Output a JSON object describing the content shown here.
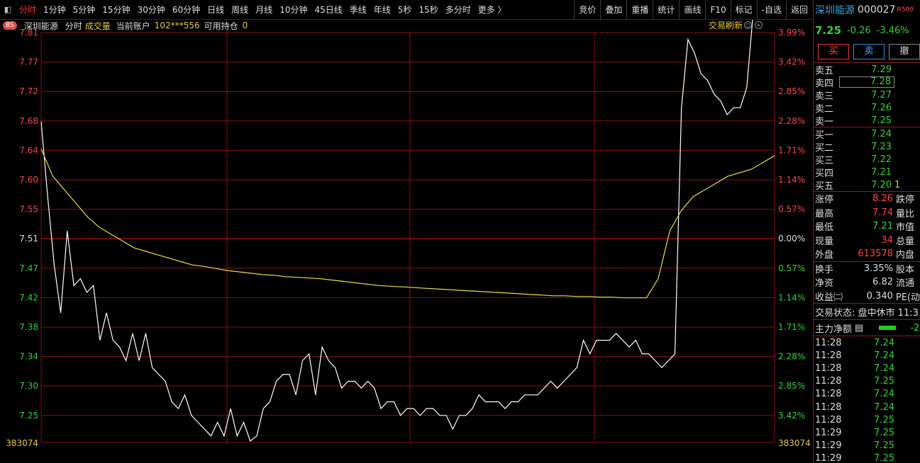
{
  "toolbar": {
    "tabs": [
      "分时",
      "1分钟",
      "5分钟",
      "15分钟",
      "30分钟",
      "60分钟",
      "日线",
      "周线",
      "月线",
      "10分钟",
      "45日线",
      "季线",
      "年线",
      "5秒",
      "15秒",
      "多分时",
      "更多 〉"
    ],
    "active_tab": "分时",
    "tools": [
      "竞价",
      "叠加",
      "重播",
      "统计",
      "画线",
      "F10",
      "标记",
      "-自选",
      "返回"
    ]
  },
  "infobar": {
    "badge": "BS",
    "name": "深圳能源",
    "mode": "分时",
    "volume_label": "成交量",
    "account_label": "当前账户",
    "account": "102***556",
    "position_label": "可用持仓",
    "position": "0",
    "refresh": "交易刷新"
  },
  "chart_data": {
    "type": "line",
    "y_labels_left": [
      "7.81",
      "7.77",
      "7.72",
      "7.68",
      "7.64",
      "7.60",
      "7.55",
      "7.51",
      "7.47",
      "7.42",
      "7.38",
      "7.34",
      "7.30",
      "7.25"
    ],
    "y_labels_right": [
      "3.99%",
      "3.42%",
      "2.85%",
      "2.28%",
      "1.71%",
      "1.14%",
      "0.57%",
      "0.00%",
      "0.57%",
      "1.14%",
      "1.71%",
      "2.28%",
      "2.85%",
      "3.42%"
    ],
    "ylim": [
      7.21,
      7.81
    ],
    "prev_close": 7.51,
    "volume_label_left": "383074",
    "volume_label_right": "383074",
    "colors": {
      "price": "#ffffff",
      "average": "#e8e03a",
      "grid": "#8a1010",
      "up": "#ff4444",
      "down": "#33d433"
    },
    "series": [
      {
        "values": [
          7.68,
          7.57,
          7.47,
          7.4,
          7.52,
          7.44,
          7.45,
          7.43,
          7.44,
          7.36,
          7.4,
          7.36,
          7.35,
          7.33,
          7.37,
          7.33,
          7.37,
          7.32,
          7.31,
          7.3,
          7.27,
          7.26,
          7.28,
          7.25,
          7.24,
          7.23,
          7.22,
          7.24,
          7.22,
          7.26,
          7.22,
          7.24,
          7.21,
          7.22,
          7.26,
          7.27,
          7.3,
          7.31,
          7.31,
          7.28,
          7.33,
          7.34,
          7.28,
          7.35,
          7.33,
          7.32,
          7.29,
          7.3,
          7.3,
          7.29,
          7.3,
          7.29,
          7.26,
          7.27,
          7.27,
          7.25,
          7.26,
          7.26,
          7.25,
          7.26,
          7.26,
          7.25,
          7.25,
          7.23,
          7.25,
          7.25,
          7.26,
          7.28,
          7.27,
          7.27,
          7.27,
          7.26,
          7.27,
          7.27,
          7.28,
          7.28,
          7.28,
          7.29,
          7.3,
          7.29,
          7.3,
          7.31,
          7.32,
          7.36,
          7.34,
          7.36,
          7.36,
          7.36,
          7.37,
          7.36,
          7.35,
          7.36,
          7.34,
          7.34,
          7.33,
          7.32,
          7.33,
          7.34,
          7.7,
          7.8,
          7.78,
          7.75,
          7.74,
          7.72,
          7.71,
          7.69,
          7.7,
          7.7,
          7.73,
          7.85
        ]
      },
      {
        "values": [
          7.64,
          7.6,
          7.58,
          7.56,
          7.54,
          7.525,
          7.515,
          7.505,
          7.495,
          7.49,
          7.485,
          7.48,
          7.475,
          7.47,
          7.468,
          7.465,
          7.462,
          7.46,
          7.458,
          7.456,
          7.455,
          7.453,
          7.452,
          7.451,
          7.45,
          7.448,
          7.446,
          7.444,
          7.442,
          7.44,
          7.439,
          7.438,
          7.437,
          7.436,
          7.435,
          7.434,
          7.433,
          7.432,
          7.431,
          7.43,
          7.429,
          7.428,
          7.427,
          7.426,
          7.425,
          7.425,
          7.424,
          7.424,
          7.423,
          7.423,
          7.422,
          7.422,
          7.422,
          7.45,
          7.52,
          7.55,
          7.57,
          7.58,
          7.59,
          7.6,
          7.605,
          7.61,
          7.62,
          7.63
        ]
      }
    ]
  },
  "panel": {
    "name": "深圳能源",
    "code": "000027",
    "r500": "R500",
    "price": "7.25",
    "change": "-0.26",
    "change_pct": "-3.46%",
    "buttons": [
      "买",
      "卖",
      "撤"
    ],
    "asks": [
      {
        "label": "卖五",
        "price": "7.29"
      },
      {
        "label": "卖四",
        "price": "7.28"
      },
      {
        "label": "卖三",
        "price": "7.27"
      },
      {
        "label": "卖二",
        "price": "7.26"
      },
      {
        "label": "卖一",
        "price": "7.25"
      }
    ],
    "bids": [
      {
        "label": "买一",
        "price": "7.24",
        "vol": ""
      },
      {
        "label": "买二",
        "price": "7.23",
        "vol": ""
      },
      {
        "label": "买三",
        "price": "7.22",
        "vol": ""
      },
      {
        "label": "买四",
        "price": "7.21",
        "vol": ""
      },
      {
        "label": "买五",
        "price": "7.20",
        "vol": "1"
      }
    ],
    "stats": [
      {
        "label": "涨停",
        "value": "8.26",
        "color": "red",
        "label2": "跌停"
      },
      {
        "label": "最高",
        "value": "7.74",
        "color": "red",
        "label2": "量比"
      },
      {
        "label": "最低",
        "value": "7.21",
        "color": "green",
        "label2": "市值"
      },
      {
        "label": "现量",
        "value": "34",
        "color": "red",
        "label2": "总量"
      },
      {
        "label": "外盘",
        "value": "613578",
        "color": "red",
        "label2": "内盘"
      }
    ],
    "stats2": [
      {
        "label": "换手",
        "value": "3.35%",
        "color": "white",
        "label2": "股本"
      },
      {
        "label": "净资",
        "value": "6.82",
        "color": "white",
        "label2": "流通"
      },
      {
        "label": "收益㈡",
        "value": "0.340",
        "color": "white",
        "label2": "PE(动"
      }
    ],
    "status": "交易状态: 盘中休市 11:3",
    "flow_label": "主力净额",
    "flow_value": "-2",
    "trades": [
      {
        "time": "11:28",
        "price": "7.24"
      },
      {
        "time": "11:28",
        "price": "7.24"
      },
      {
        "time": "11:28",
        "price": "7.24"
      },
      {
        "time": "11:28",
        "price": "7.25"
      },
      {
        "time": "11:28",
        "price": "7.24"
      },
      {
        "time": "11:28",
        "price": "7.24"
      },
      {
        "time": "11:28",
        "price": "7.25"
      },
      {
        "time": "11:29",
        "price": "7.25"
      },
      {
        "time": "11:29",
        "price": "7.25"
      },
      {
        "time": "11:29",
        "price": "7.25"
      }
    ]
  }
}
